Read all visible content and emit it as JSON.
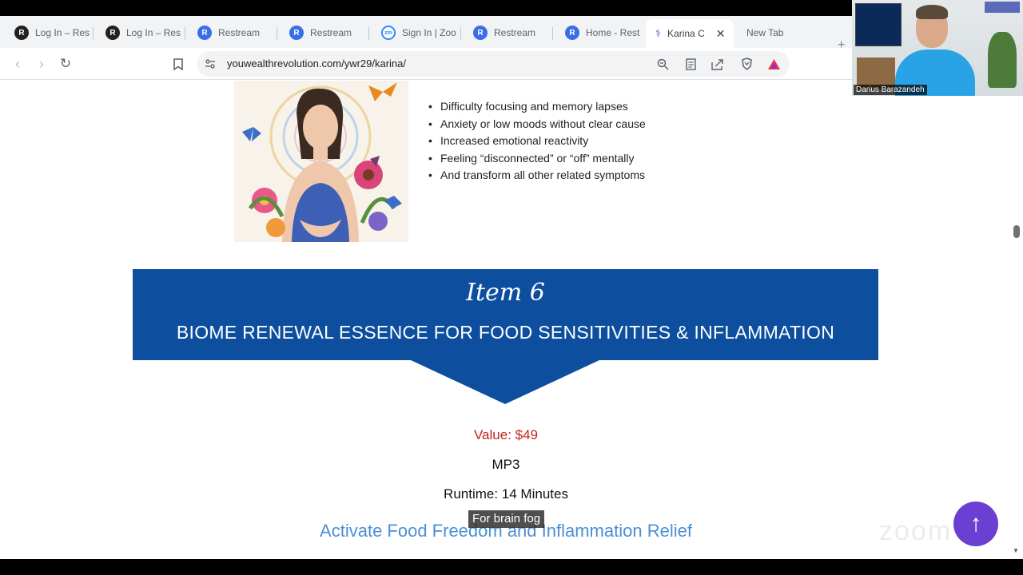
{
  "browser": {
    "tabs": [
      {
        "title": "Log In – Res",
        "favicon": "restream-logo-black"
      },
      {
        "title": "Log In – Res",
        "favicon": "restream-logo-black"
      },
      {
        "title": "Restream",
        "favicon": "restream-logo-blue"
      },
      {
        "title": "Restream",
        "favicon": "restream-logo-blue"
      },
      {
        "title": "Sign In | Zoo",
        "favicon": "zoom-logo"
      },
      {
        "title": "Restream",
        "favicon": "restream-logo-blue"
      },
      {
        "title": "Home - Rest",
        "favicon": "restream-logo-blue"
      },
      {
        "title": "Karina C",
        "favicon": "dna-logo",
        "active": true
      },
      {
        "title": "New Tab",
        "favicon": ""
      }
    ],
    "url": "youwealthrevolution.com/ywr29/karina/"
  },
  "video": {
    "participant_name": "Darius Barazandeh"
  },
  "page": {
    "bullets": [
      "Difficulty focusing and memory lapses",
      "Anxiety or low moods without clear cause",
      "Increased emotional reactivity",
      "Feeling “disconnected” or “off” mentally",
      "And transform all other related symptoms"
    ],
    "banner": {
      "item_label": "Item 6",
      "title": "BIOME RENEWAL ESSENCE FOR FOOD SENSITIVITIES & INFLAMMATION"
    },
    "value": "Value: $49",
    "format": "MP3",
    "runtime": "Runtime: 14 Minutes",
    "caption": "For brain fog",
    "headline": "Activate Food Freedom and Inflammation Relief"
  },
  "colors": {
    "banner_blue": "#0d4f9e",
    "value_red": "#c0251f",
    "headline_blue": "#4b8fd6",
    "fab_purple": "#6b3fd1"
  }
}
